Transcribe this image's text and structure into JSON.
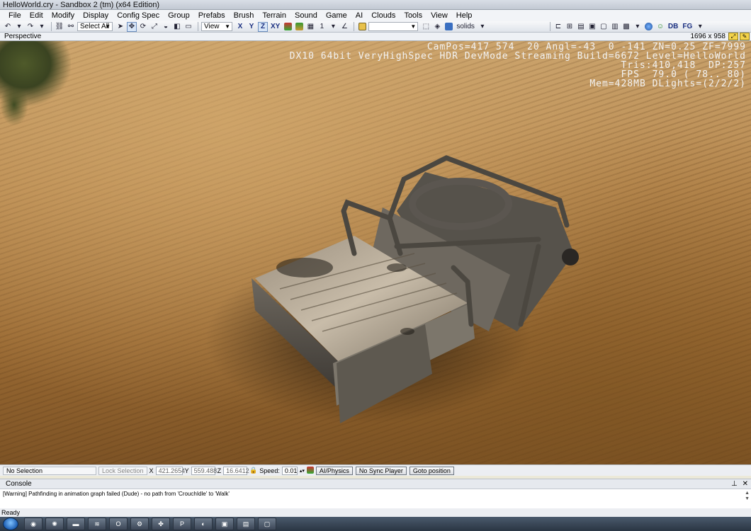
{
  "window": {
    "title": "HelloWorld.cry - Sandbox 2 (tm) (x64 Edition)"
  },
  "menu": {
    "items": [
      "File",
      "Edit",
      "Modify",
      "Display",
      "Config Spec",
      "Group",
      "Prefabs",
      "Brush",
      "Terrain",
      "Sound",
      "Game",
      "AI",
      "Clouds",
      "Tools",
      "View",
      "Help"
    ]
  },
  "toolbar": {
    "select_mode": "Select All",
    "view_combo": "View",
    "axis_x": "X",
    "axis_y": "Y",
    "axis_z": "Z",
    "axis_xy": "XY",
    "snap_value": "1",
    "render_mode": "solids",
    "db_label": "DB",
    "fg_label": "FG"
  },
  "viewport": {
    "name": "Perspective",
    "resolution": "1696 x 958",
    "stats": [
      "CamPos=417 574  20 Angl=-43  0 -141 ZN=0.25 ZF=7999",
      "DX10 64bit VeryHighSpec HDR DevMode Streaming Build=6672 Level=HelloWorld",
      "Tris:410,418  DP:257",
      "FPS  79.0 ( 78.. 80)",
      "Mem=428MB DLights=(2/2/2)"
    ]
  },
  "statusbar": {
    "selection": "No Selection",
    "lock_selection": "Lock Selection",
    "x_label": "X",
    "x_value": "421.2654",
    "y_label": "Y",
    "y_value": "559.488",
    "z_label": "Z",
    "z_value": "16.6412",
    "speed_label": "Speed:",
    "speed_value": "0.01",
    "ai_physics": "AI/Physics",
    "no_sync_player": "No Sync Player",
    "goto_position": "Goto position"
  },
  "console": {
    "title": "Console",
    "pin_icon": "pin-icon",
    "close_icon": "close-icon",
    "message": "[Warning] Pathfinding in animation graph failed (Dude) - no path from 'CrouchIdle' to 'Walk'"
  },
  "status": {
    "ready": "Ready"
  },
  "taskbar": {
    "apps": [
      "chrome-icon",
      "firefox-icon",
      "folder-icon",
      "app-icon",
      "app-icon",
      "steam-icon",
      "app-icon",
      "app-icon",
      "app-icon",
      "app-icon",
      "app-icon",
      "app-icon"
    ]
  }
}
